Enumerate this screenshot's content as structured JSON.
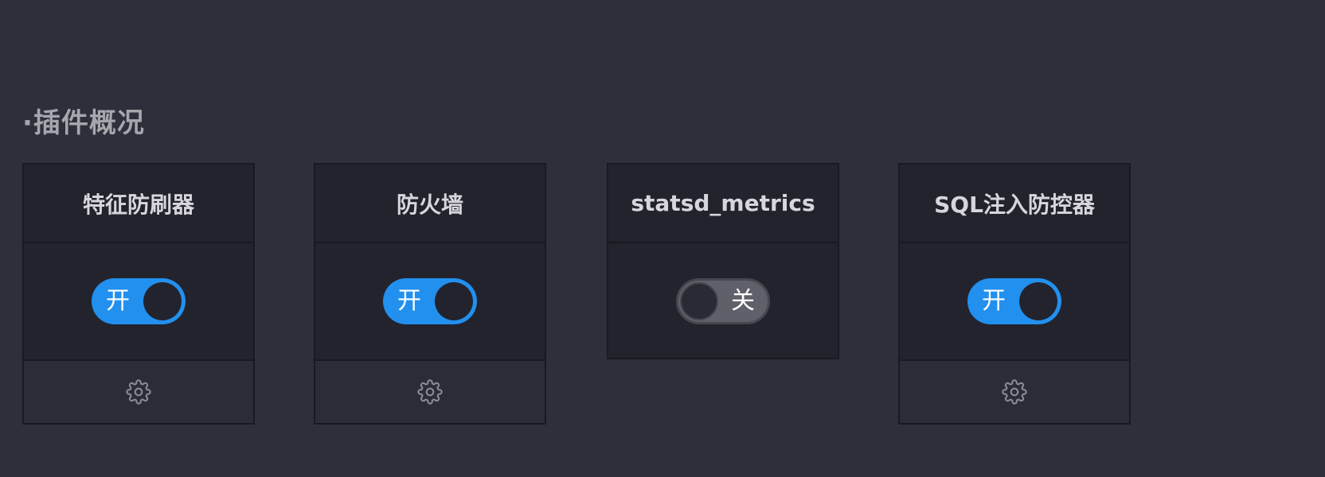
{
  "section": {
    "title": "·插件概况"
  },
  "plugins": [
    {
      "name": "特征防刷器",
      "switch_label": "开",
      "enabled": true,
      "has_settings": true,
      "settings_icon": "gear-icon"
    },
    {
      "name": "防火墙",
      "switch_label": "开",
      "enabled": true,
      "has_settings": true,
      "settings_icon": "gear-icon"
    },
    {
      "name": "statsd_metrics",
      "switch_label": "关",
      "enabled": false,
      "has_settings": false
    },
    {
      "name": "SQL注入防控器",
      "switch_label": "开",
      "enabled": true,
      "has_settings": true,
      "settings_icon": "gear-icon"
    }
  ],
  "colors": {
    "background": "#2f2f3c",
    "card": "#23232e",
    "switch_on": "#2290ee",
    "switch_off": "#60606a"
  }
}
